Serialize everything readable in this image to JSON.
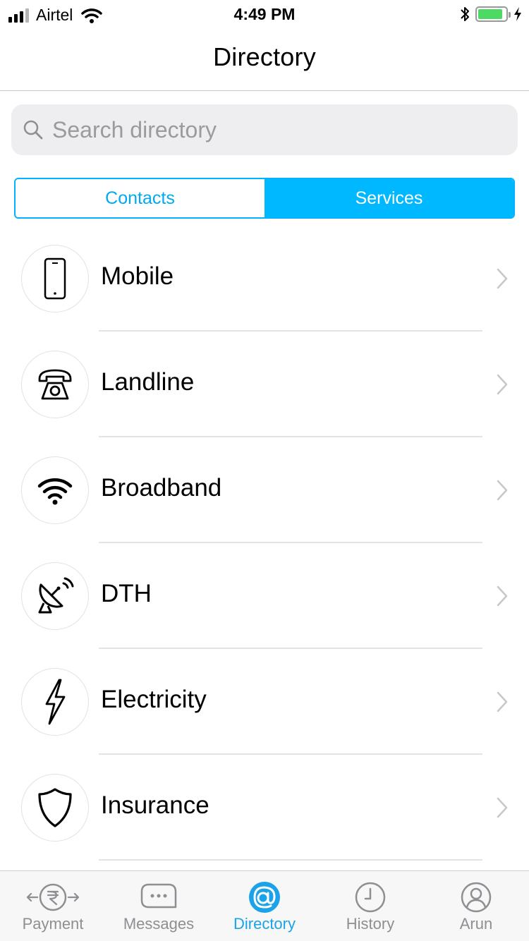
{
  "status_bar": {
    "carrier": "Airtel",
    "time": "4:49 PM",
    "signal_bars": 4,
    "signal_active": 3,
    "battery_level": 0.9,
    "battery_color": "#4cd964"
  },
  "header": {
    "title": "Directory"
  },
  "search": {
    "placeholder": "Search directory",
    "value": ""
  },
  "segments": {
    "items": [
      {
        "label": "Contacts"
      },
      {
        "label": "Services"
      }
    ],
    "selected": "Services",
    "accent_color": "#00b8ff"
  },
  "services": [
    {
      "label": "Mobile",
      "icon": "mobile-phone-icon"
    },
    {
      "label": "Landline",
      "icon": "landline-phone-icon"
    },
    {
      "label": "Broadband",
      "icon": "wifi-icon"
    },
    {
      "label": "DTH",
      "icon": "satellite-dish-icon"
    },
    {
      "label": "Electricity",
      "icon": "lightning-bolt-icon"
    },
    {
      "label": "Insurance",
      "icon": "shield-icon"
    }
  ],
  "tabbar": {
    "items": [
      {
        "label": "Payment",
        "icon": "rupee-transfer-icon"
      },
      {
        "label": "Messages",
        "icon": "chat-bubble-icon"
      },
      {
        "label": "Directory",
        "icon": "at-sign-icon"
      },
      {
        "label": "History",
        "icon": "clock-icon"
      },
      {
        "label": "Arun",
        "icon": "user-profile-icon"
      }
    ],
    "selected": "Directory",
    "active_color": "#1aa3e8"
  }
}
